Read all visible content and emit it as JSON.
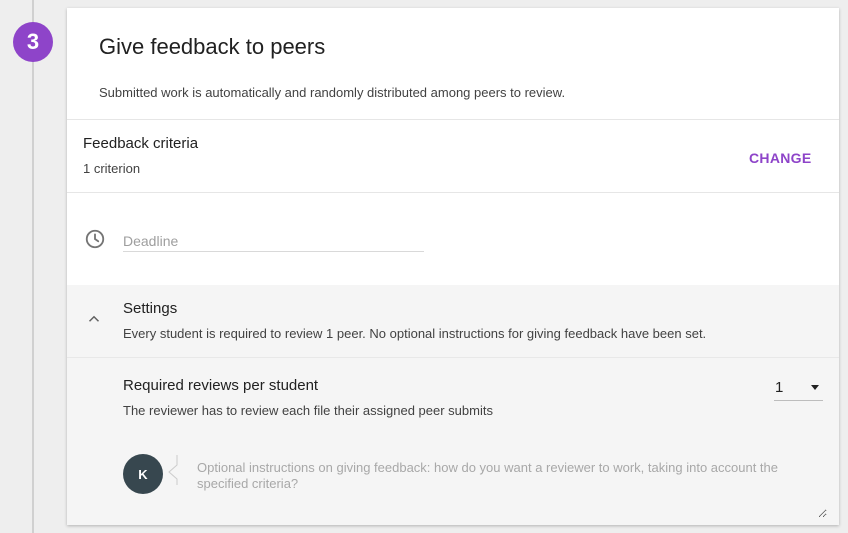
{
  "step": {
    "number": "3"
  },
  "card": {
    "title": "Give feedback to peers",
    "description": "Submitted work is automatically and randomly distributed among peers to review."
  },
  "criteria": {
    "title": "Feedback criteria",
    "count": "1 criterion",
    "change_label": "CHANGE"
  },
  "deadline": {
    "placeholder": "Deadline",
    "icon": "clock-icon"
  },
  "settings": {
    "title": "Settings",
    "summary": "Every student is required to review 1 peer. No optional instructions for giving feedback have been set.",
    "expanded": true,
    "reviews": {
      "title": "Required reviews per student",
      "description": "The reviewer has to review each file their assigned peer submits",
      "value": "1"
    },
    "avatar": {
      "initial": "K"
    },
    "instructions": {
      "placeholder": "Optional instructions on giving feedback: how do you want a reviewer to work, taking into account the specified criteria?"
    }
  },
  "colors": {
    "accent": "#8e44c9",
    "avatar": "#37474f",
    "settings_bg": "#f5f5f5"
  }
}
